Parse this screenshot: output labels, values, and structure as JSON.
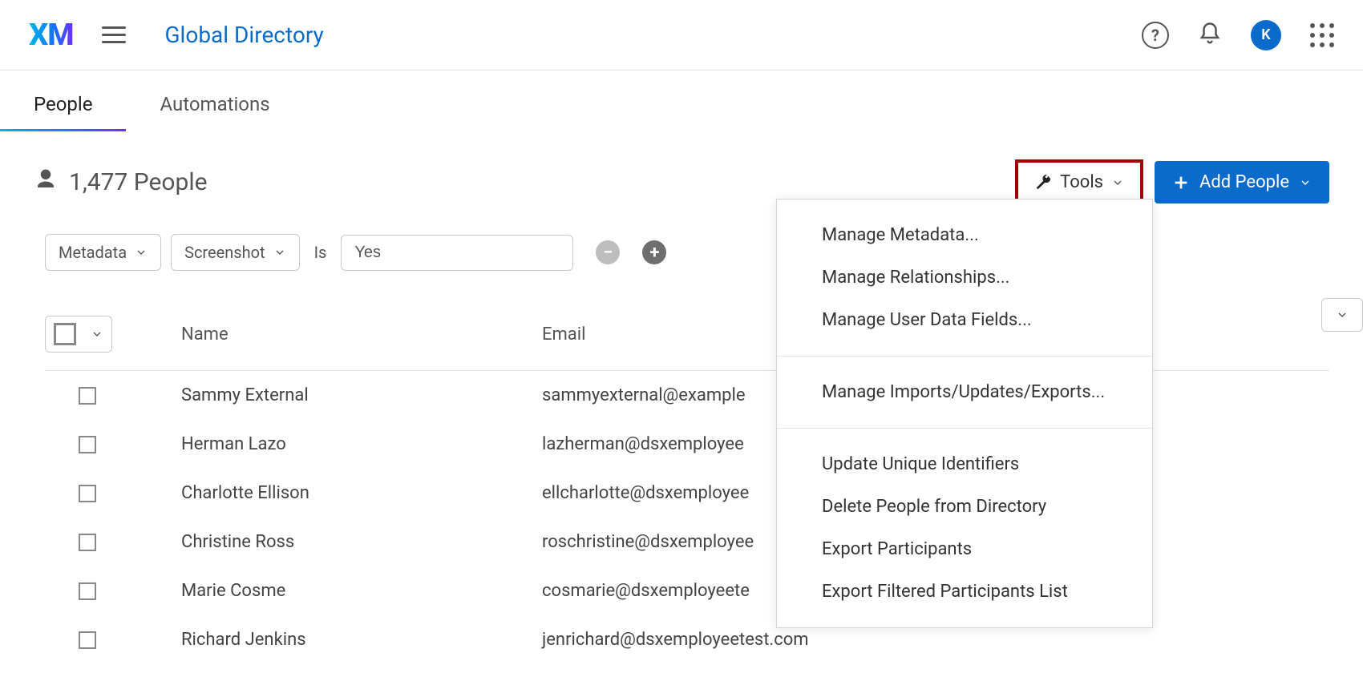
{
  "header": {
    "logo_text": "XM",
    "page_title": "Global Directory",
    "avatar_initial": "K"
  },
  "tabs": {
    "people": "People",
    "automations": "Automations",
    "active": "people"
  },
  "summary": {
    "count_label": "1,477 People"
  },
  "actions": {
    "tools_label": "Tools",
    "add_people_label": "Add People"
  },
  "filter": {
    "field": "Metadata",
    "subfield": "Screenshot",
    "operator": "Is",
    "value": "Yes"
  },
  "table": {
    "columns": {
      "name": "Name",
      "email": "Email"
    },
    "rows": [
      {
        "name": "Sammy External",
        "email": "sammyexternal@example"
      },
      {
        "name": "Herman Lazo",
        "email": "lazherman@dsxemployee"
      },
      {
        "name": "Charlotte Ellison",
        "email": "ellcharlotte@dsxemployee"
      },
      {
        "name": "Christine Ross",
        "email": "roschristine@dsxemployee"
      },
      {
        "name": "Marie Cosme",
        "email": "cosmarie@dsxemployeete"
      },
      {
        "name": "Richard Jenkins",
        "email": "jenrichard@dsxemployeetest.com"
      }
    ]
  },
  "tools_menu": {
    "sections": [
      {
        "items": [
          "Manage Metadata...",
          "Manage Relationships...",
          "Manage User Data Fields..."
        ]
      },
      {
        "items": [
          "Manage Imports/Updates/Exports..."
        ]
      },
      {
        "items": [
          "Update Unique Identifiers",
          "Delete People from Directory",
          "Export Participants",
          "Export Filtered Participants List"
        ]
      }
    ]
  }
}
